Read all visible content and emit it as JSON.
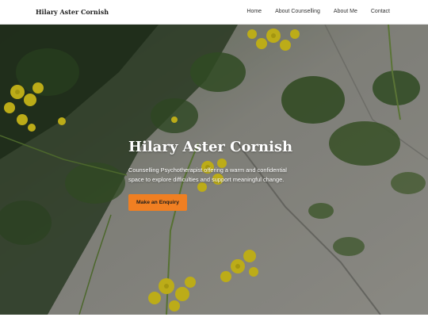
{
  "header": {
    "site_title": "Hilary Aster Cornish",
    "nav": [
      "Home",
      "About Counselling",
      "About Me",
      "Contact"
    ]
  },
  "hero": {
    "title": "Hilary Aster Cornish",
    "text": "Counselling Psychotherapist offering a warm and confidential space to explore difficulties and support meaningful change.",
    "cta_label": "Make an Enquiry"
  },
  "colors": {
    "accent": "#f07f22",
    "header_bg": "#ffffff",
    "hero_text": "#ffffff"
  }
}
